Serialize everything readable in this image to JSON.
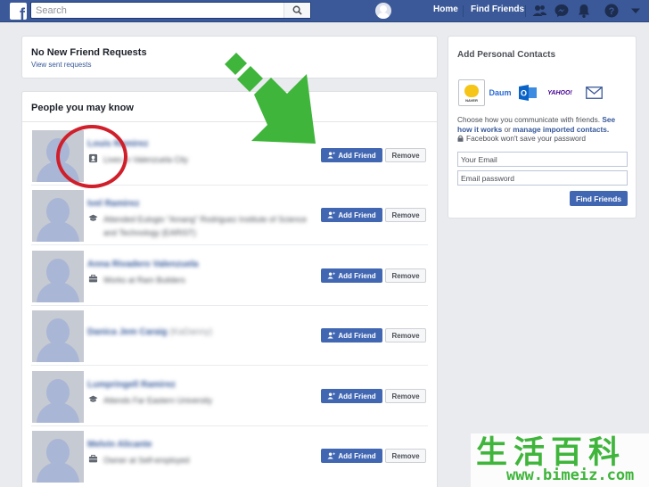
{
  "topbar": {
    "search_placeholder": "Search",
    "nav": {
      "home": "Home",
      "find_friends": "Find Friends"
    }
  },
  "requests": {
    "title": "No New Friend Requests",
    "link": "View sent requests"
  },
  "pymk": {
    "title": "People you may know",
    "add_label": "Add Friend",
    "remove_label": "Remove",
    "people": [
      {
        "name": "Louis Ramirez",
        "extra": "",
        "info_icon": "location-icon",
        "info": "Lives in Valenzuela City"
      },
      {
        "name": "Ivel Ramirez",
        "extra": "",
        "info_icon": "school-icon",
        "info": "Attended Eulogio \"Amang\" Rodriguez Institute of Science and Technology (EARIST)"
      },
      {
        "name": "Anna Rivadero Valenzuela",
        "extra": "",
        "info_icon": "work-icon",
        "info": "Works at Ram Builders"
      },
      {
        "name": "Danica Jem Caraig",
        "extra": "(KaDanny)",
        "info_icon": "",
        "info": ""
      },
      {
        "name": "Lumpringell Ramirez",
        "extra": "",
        "info_icon": "school-icon",
        "info": "Attends Far Eastern University"
      },
      {
        "name": "Melvin Alicante",
        "extra": "",
        "info_icon": "work-icon",
        "info": "Owner at Self-employed"
      }
    ]
  },
  "contacts": {
    "title": "Add Personal Contacts",
    "providers": {
      "naver": "NAVER",
      "daum": "Daum",
      "outlook": "O",
      "yahoo": "YAHOO!"
    },
    "desc_prefix": "Choose how you communicate with friends.",
    "desc_link1": "See how it works",
    "desc_mid": "or",
    "desc_link2": "manage imported contacts.",
    "privacy": "Facebook won't save your password",
    "email_placeholder": "Your Email",
    "password_placeholder": "Email password",
    "find_button": "Find Friends"
  },
  "watermark": {
    "chars": "生活百科",
    "url": "www.bimeiz.com"
  },
  "colors": {
    "brand_blue": "#3b5998",
    "button_blue": "#4267b2",
    "annotation_red": "#d01f2a",
    "annotation_green": "#3fb53b"
  }
}
